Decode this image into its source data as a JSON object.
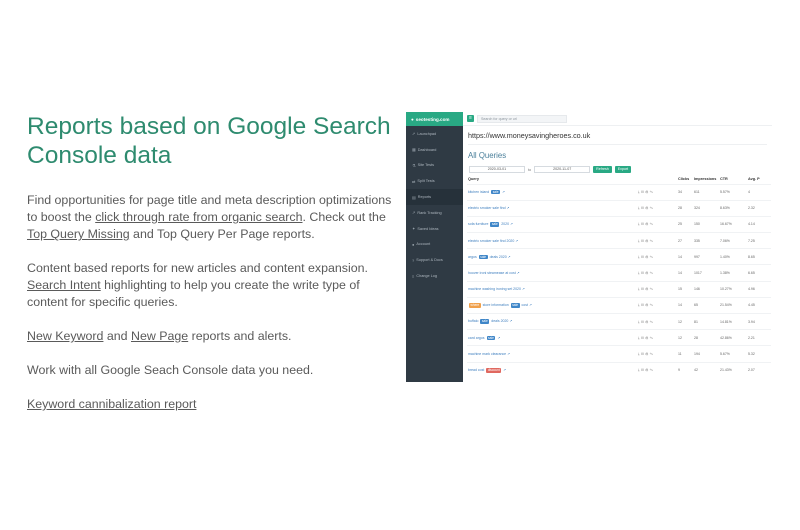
{
  "left": {
    "heading": "Reports based on Google Search Console data",
    "p1_prefix": "Find opportunities for page title and meta description optimizations to boost the ",
    "p1_link1": "click through rate from organic search",
    "p1_mid": ". Check out the ",
    "p1_link2": "Top Query Missing",
    "p1_suffix": " and Top Query Per Page reports.",
    "p2_prefix": "Content based reports for new articles and content expansion. ",
    "p2_link": "Search Intent",
    "p2_suffix": " highlighting to help you create the write type of content for specific queries.",
    "p3_link1": "New Keyword",
    "p3_mid": " and ",
    "p3_link2": "New Page",
    "p3_suffix": " reports and alerts.",
    "p4": "Work with all Google Seach Console data you need.",
    "p5_link": "Keyword cannibalization report"
  },
  "app": {
    "logo": "seotesting.com",
    "search_placeholder": "Search for query or url",
    "sidebar": [
      {
        "label": "Launchpad",
        "icon": "rocket-icon"
      },
      {
        "label": "Dashboard",
        "icon": "dashboard-icon"
      },
      {
        "label": "Site Tests",
        "icon": "flask-icon"
      },
      {
        "label": "Split Tests",
        "icon": "split-icon"
      },
      {
        "label": "Reports",
        "icon": "report-icon"
      },
      {
        "label": "Rank Tracking",
        "icon": "chart-icon"
      },
      {
        "label": "Saved Ideas",
        "icon": "bulb-icon"
      },
      {
        "label": "Account",
        "icon": "user-icon"
      },
      {
        "label": "Support & Docs",
        "icon": "help-icon"
      },
      {
        "label": "Change Log",
        "icon": "list-icon"
      }
    ],
    "site_url": "https://www.moneysavingheroes.co.uk",
    "section_title": "All Queries",
    "date_from": "2020-03-01",
    "date_to_label": "to",
    "date_to": "2020-11-07",
    "refresh_label": "Refresh",
    "export_label": "Export",
    "columns": [
      "Query",
      "",
      "Clicks",
      "Impressions",
      "CTR",
      "Avg. P"
    ],
    "rows": [
      {
        "q": "kitchen island ",
        "tag": "sale",
        "tag_color": "blue",
        "after": "",
        "clicks": "34",
        "impr": "611",
        "ctr": "5.57%",
        "pos": "4"
      },
      {
        "q": "electric smoker sale find ",
        "tag": "",
        "tag_color": "",
        "after": "",
        "clicks": "28",
        "impr": "324",
        "ctr": "8.63%",
        "pos": "2.32"
      },
      {
        "q": "sofa furniture ",
        "tag": "sale",
        "tag_color": "blue",
        "after": " 2020",
        "clicks": "25",
        "impr": "150",
        "ctr": "16.67%",
        "pos": "4.14"
      },
      {
        "q": "electric smoker sale find 2020 ",
        "tag": "",
        "tag_color": "",
        "after": "",
        "clicks": "27",
        "impr": "335",
        "ctr": "7.06%",
        "pos": "7.25"
      },
      {
        "q": "argos ",
        "tag": "sale",
        "tag_color": "blue",
        "after": " deals 2020",
        "clicks": "14",
        "impr": "997",
        "ctr": "1.40%",
        "pos": "8.65"
      },
      {
        "q": "hoover ironi steamease at cost ",
        "tag": "",
        "tag_color": "",
        "after": "",
        "clicks": "14",
        "impr": "1017",
        "ctr": "1.38%",
        "pos": "6.65"
      },
      {
        "q": "machine washing ironing set 2020 ",
        "tag": "",
        "tag_color": "",
        "after": "",
        "clicks": "15",
        "impr": "146",
        "ctr": "10.27%",
        "pos": "4.96"
      },
      {
        "q": "",
        "tag": "where",
        "tag_color": "orange",
        "after": " store information ",
        "tag2": "sale",
        "after2": " cost",
        "clicks": "14",
        "impr": "65",
        "ctr": "21.54%",
        "pos": "4.45"
      },
      {
        "q": "buffalo ",
        "tag": "sale",
        "tag_color": "blue",
        "after": " deals 2020",
        "clicks": "12",
        "impr": "81",
        "ctr": "14.81%",
        "pos": "3.94"
      },
      {
        "q": "card argos ",
        "tag": "sale",
        "tag_color": "blue",
        "after": "",
        "clicks": "12",
        "impr": "28",
        "ctr": "42.86%",
        "pos": "2.21"
      },
      {
        "q": "machine mark clearance ",
        "tag": "",
        "tag_color": "",
        "after": "",
        "clicks": "11",
        "impr": "194",
        "ctr": "5.67%",
        "pos": "5.32"
      },
      {
        "q": "bread cost ",
        "tag": "discount",
        "tag_color": "red",
        "after": "",
        "clicks": "9",
        "impr": "42",
        "ctr": "21.43%",
        "pos": "2.07"
      }
    ]
  }
}
